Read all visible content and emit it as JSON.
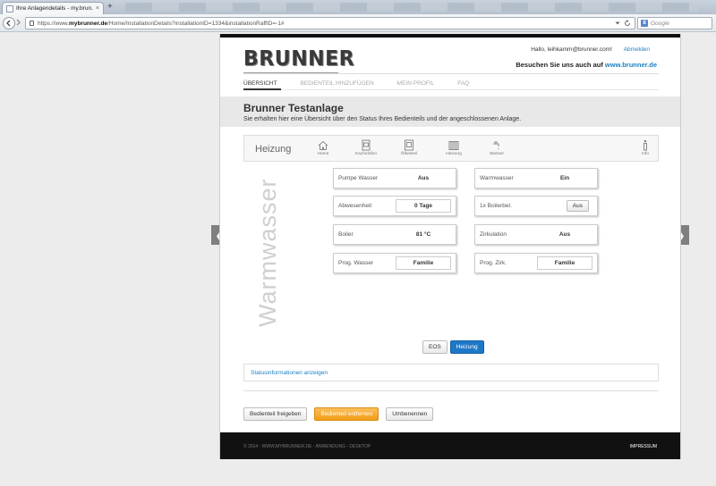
{
  "browser": {
    "tab_title": "Ihre Anlagendetails - my.brun...",
    "tab_close": "×",
    "new_tab": "+",
    "url_prefix": "https://www.",
    "url_domain": "mybrunner.de",
    "url_path": "/Home/InstallationDetails?installationID=1334&installationRaffID=-1#",
    "search_placeholder": "Google",
    "search_engine_icon": "google-icon"
  },
  "header": {
    "logo": "BRUNNER",
    "hello": "Hallo, leihkamm@brunner.com!",
    "logout": "Abmelden",
    "visit_text": "Besuchen Sie uns auch auf ",
    "visit_link": "www.brunner.de"
  },
  "menu": [
    {
      "label": "ÜBERSICHT",
      "active": true
    },
    {
      "label": "BEDIENTEIL HINZUFÜGEN",
      "active": false
    },
    {
      "label": "MEIN PROFIL",
      "active": false
    },
    {
      "label": "FAQ",
      "active": false
    }
  ],
  "title": {
    "heading": "Brunner Testanlage",
    "subtitle": "Sie erhalten hier eine Übersicht über den Status Ihres Bedienteils und der angeschlossenen Anlage."
  },
  "device_nav": {
    "title": "Heizung",
    "items": [
      {
        "label": "Home",
        "icon": "home-icon"
      },
      {
        "label": "Kachelofen",
        "icon": "stove-icon"
      },
      {
        "label": "Ölkessel",
        "icon": "boiler-icon"
      },
      {
        "label": "Heizung",
        "icon": "radiator-icon"
      },
      {
        "label": "Wasser",
        "icon": "water-tap-icon"
      },
      {
        "label": "Info",
        "icon": "info-icon"
      }
    ]
  },
  "section_label": "Warmwasser",
  "panels": {
    "pumpe_wasser": {
      "label": "Pumpe Wasser",
      "value": "Aus"
    },
    "abwesenheit": {
      "label": "Abwesenheit",
      "value": "0 Tage"
    },
    "boiler": {
      "label": "Boiler",
      "value": "81 °C"
    },
    "prog_wasser": {
      "label": "Prog. Wasser",
      "value": "Familie"
    },
    "warmwasser": {
      "label": "Warmwasser",
      "value": "Ein"
    },
    "boilerbel": {
      "label": "1x Boilerbel.",
      "value": "Aus"
    },
    "zirkulation": {
      "label": "Zirkulation",
      "value": "Aus"
    },
    "prog_zirk": {
      "label": "Prog. Zirk.",
      "value": "Familie"
    }
  },
  "toggle": {
    "eos": "EOS",
    "heizung": "Heizung"
  },
  "status_link": "Statusinformationen anzeigen",
  "actions": {
    "freigeben": "Bedienteil freigeben",
    "entfernen": "Bedienteil entfernen",
    "umbenennen": "Umbenennen"
  },
  "footer": {
    "left": "© 2014 - WWW.MYBRUNNER.DE - ANWENDUNG - DESKTOP",
    "right": "IMPRESSUM"
  },
  "carousel": {
    "prev": "❮",
    "next": "❯"
  },
  "colors": {
    "accent_blue": "#1e78c8",
    "orange": "#f29d16",
    "link": "#1a7fc0"
  }
}
